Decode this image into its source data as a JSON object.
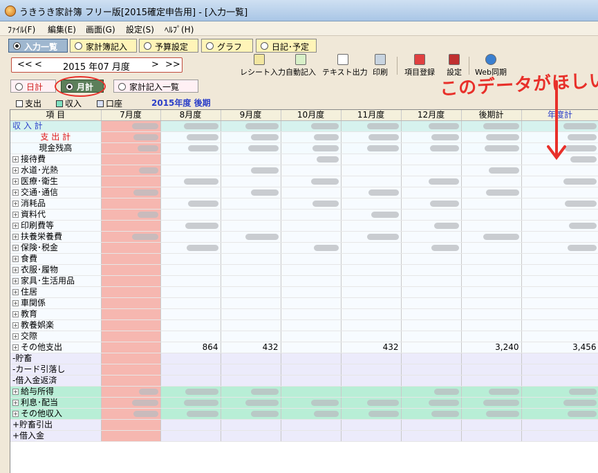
{
  "window": {
    "title": "うきうき家計簿 フリー版[2015確定申告用] - [入力一覧]"
  },
  "menu": [
    "ﾌｧｲﾙ(F)",
    "編集(E)",
    "画面(G)",
    "設定(S)",
    "ﾍﾙﾌﾟ(H)"
  ],
  "nav_tabs": [
    "入力一覧",
    "家計簿記入",
    "予算設定",
    "グラフ",
    "日記･予定"
  ],
  "period": {
    "prev_year": "<<",
    "prev": "<",
    "label": "2015 年07 月度",
    "next": ">",
    "next_year": ">>"
  },
  "tools": [
    "レシート入力",
    "自動記入",
    "テキスト出力",
    "印刷",
    "項目登録",
    "設定",
    "Web同期"
  ],
  "view_tabs": [
    "日計",
    "月計",
    "家計記入一覧"
  ],
  "filters": [
    "支出",
    "収入",
    "口座"
  ],
  "fiscal_label": "2015年度 後期",
  "columns": [
    "項 目",
    "7月度",
    "8月度",
    "9月度",
    "10月度",
    "11月度",
    "12月度",
    "後期計",
    "年度計"
  ],
  "rows": [
    {
      "label": "収 入 計",
      "type": "total-income",
      "color": "#2b3ec8"
    },
    {
      "label": "支 出 計",
      "type": "summary",
      "color": "#e01818"
    },
    {
      "label": "現金残高",
      "type": "summary",
      "color": "#000000"
    },
    {
      "label": "接待費",
      "type": "expense",
      "plus": true
    },
    {
      "label": "水道･光熱",
      "type": "expense",
      "plus": true
    },
    {
      "label": "医療･衛生",
      "type": "expense",
      "plus": true
    },
    {
      "label": "交通･通信",
      "type": "expense",
      "plus": true
    },
    {
      "label": "消耗品",
      "type": "expense",
      "plus": true
    },
    {
      "label": "資料代",
      "type": "expense",
      "plus": true
    },
    {
      "label": "印刷費等",
      "type": "expense",
      "plus": true
    },
    {
      "label": "扶養栄養費",
      "type": "expense",
      "plus": true
    },
    {
      "label": "保険･税金",
      "type": "expense",
      "plus": true
    },
    {
      "label": "食費",
      "type": "expense",
      "plus": true
    },
    {
      "label": "衣服･履物",
      "type": "expense",
      "plus": true
    },
    {
      "label": "家具･生活用品",
      "type": "expense",
      "plus": true
    },
    {
      "label": "住居",
      "type": "expense",
      "plus": true
    },
    {
      "label": "車関係",
      "type": "expense",
      "plus": true
    },
    {
      "label": "教育",
      "type": "expense",
      "plus": true
    },
    {
      "label": "教養娯楽",
      "type": "expense",
      "plus": true
    },
    {
      "label": "交際",
      "type": "expense",
      "plus": true
    },
    {
      "label": "その他支出",
      "type": "expense",
      "plus": true,
      "values": [
        "",
        "864",
        "432",
        "",
        "432",
        "",
        "3,240",
        "3,456"
      ]
    },
    {
      "label": "-貯畜",
      "type": "savings"
    },
    {
      "label": "-カード引落し",
      "type": "savings"
    },
    {
      "label": "-借入金返済",
      "type": "savings"
    },
    {
      "label": "給与所得",
      "type": "income",
      "plus": true
    },
    {
      "label": "利息･配当",
      "type": "income",
      "plus": true
    },
    {
      "label": "その他収入",
      "type": "income",
      "plus": true
    },
    {
      "label": "+貯畜引出",
      "type": "income-extra"
    },
    {
      "label": "+借入金",
      "type": "income-extra"
    }
  ],
  "annotation": "このデータがほしい"
}
